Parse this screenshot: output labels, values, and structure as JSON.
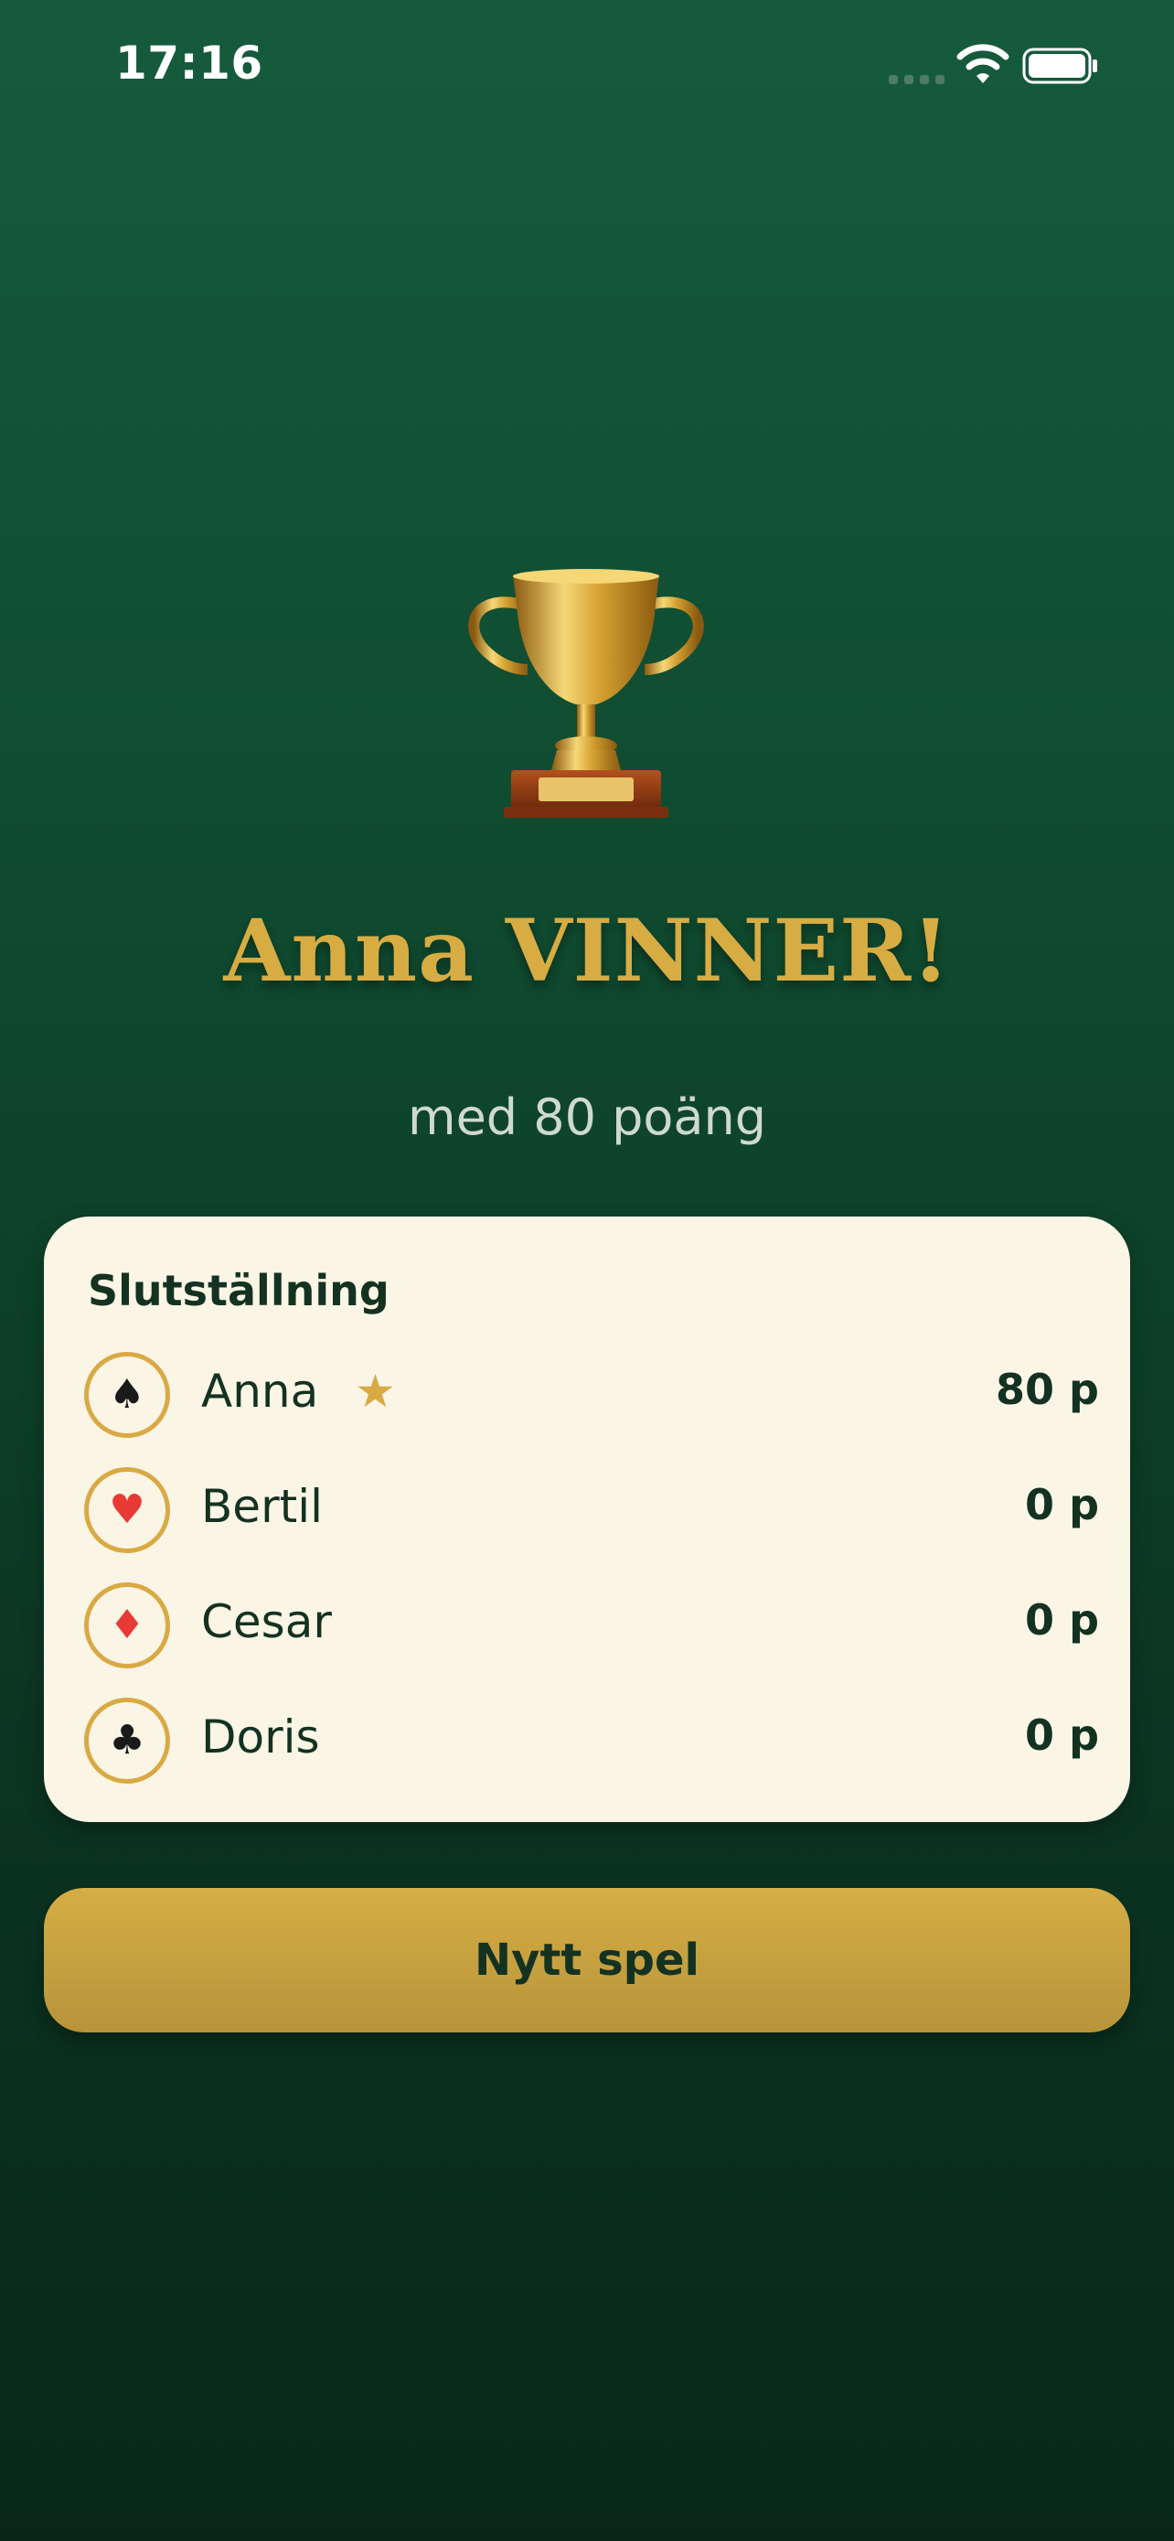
{
  "status_bar": {
    "time": "17:16",
    "icons": [
      "cellular-signal-icon",
      "wifi-icon",
      "battery-icon"
    ]
  },
  "result": {
    "trophy_icon": "trophy-icon",
    "winner_title": "Anna VINNER!",
    "winner_subtitle": "med 80 poäng"
  },
  "standings": {
    "title": "Slutställning",
    "players": [
      {
        "suit": "♠",
        "suit_icon": "spade-icon",
        "suit_color": "#1a1a1a",
        "name": "Anna",
        "winner": true,
        "score": "80 p"
      },
      {
        "suit": "♥",
        "suit_icon": "heart-icon",
        "suit_color": "#e83a34",
        "name": "Bertil",
        "winner": false,
        "score": "0 p"
      },
      {
        "suit": "♦",
        "suit_icon": "diamond-icon",
        "suit_color": "#e83a34",
        "name": "Cesar",
        "winner": false,
        "score": "0 p"
      },
      {
        "suit": "♣",
        "suit_icon": "club-icon",
        "suit_color": "#1a1a1a",
        "name": "Doris",
        "winner": false,
        "score": "0 p"
      }
    ],
    "winner_star": "★"
  },
  "actions": {
    "new_game_label": "Nytt spel"
  },
  "colors": {
    "background_top": "#165b3d",
    "background_bottom": "#08271a",
    "gold": "#d9a944",
    "card_background": "#fbf5e6",
    "dark_text": "#143221"
  }
}
